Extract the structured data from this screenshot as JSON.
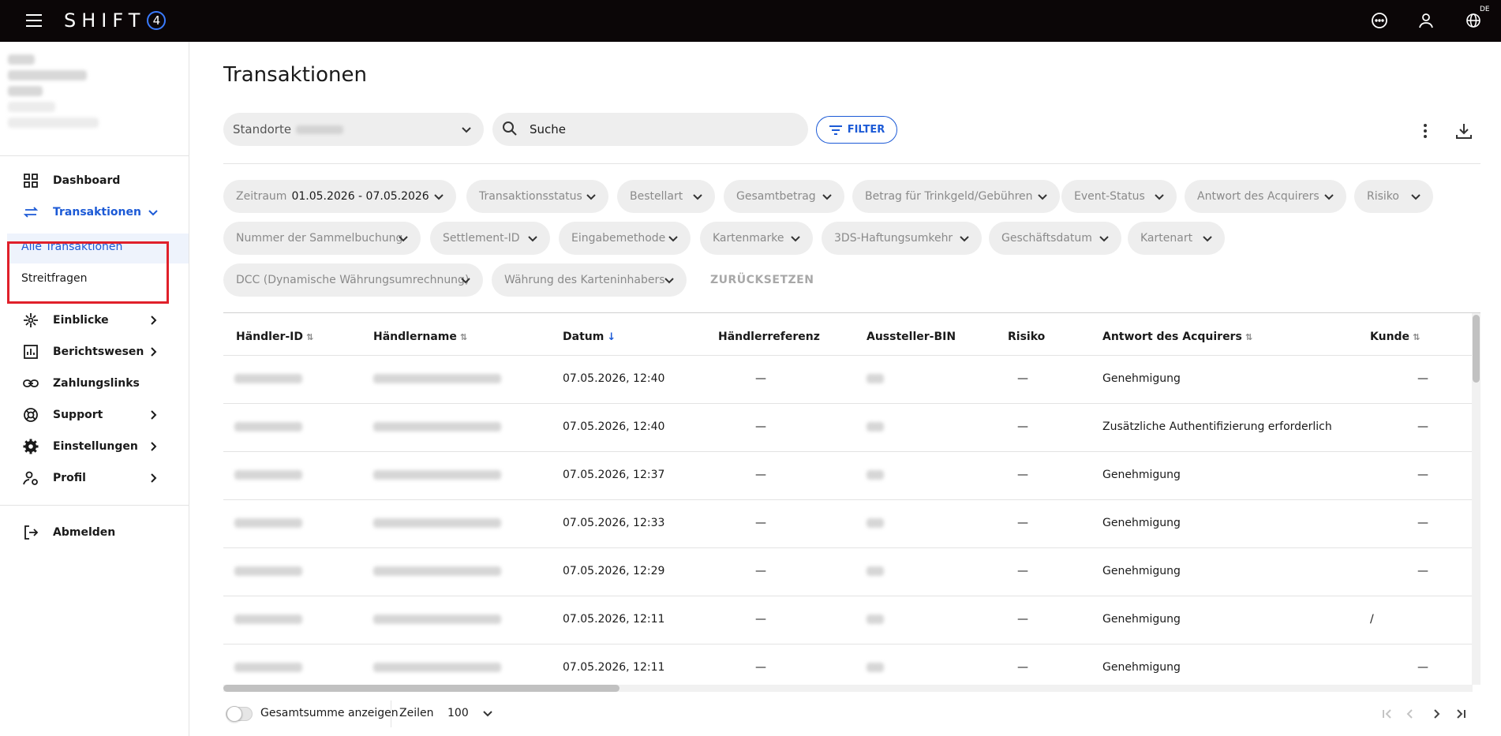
{
  "topbar": {
    "logo_text": "SHIFT",
    "logo_number": "4",
    "language_badge": "DE",
    "icons": [
      "menu-icon",
      "chat-icon",
      "user-icon",
      "globe-icon"
    ]
  },
  "sidebar": {
    "items": [
      {
        "label": "Dashboard",
        "icon": "dashboard-icon"
      },
      {
        "label": "Transaktionen",
        "icon": "transfer-arrows-icon"
      },
      {
        "label": "Alle Transaktionen"
      },
      {
        "label": "Streitfragen"
      },
      {
        "label": "Einblicke",
        "icon": "insights-icon"
      },
      {
        "label": "Berichtswesen",
        "icon": "chart-icon"
      },
      {
        "label": "Zahlungslinks",
        "icon": "link-icon"
      },
      {
        "label": "Support",
        "icon": "lifebuoy-icon"
      },
      {
        "label": "Einstellungen",
        "icon": "gear-icon"
      },
      {
        "label": "Profil",
        "icon": "profile-settings-icon"
      },
      {
        "label": "Abmelden",
        "icon": "logout-icon"
      }
    ]
  },
  "page": {
    "title": "Transaktionen",
    "location_label": "Standorte",
    "search_placeholder": "Suche",
    "filter_label": "FILTER",
    "reset_label": "ZURÜCKSETZEN"
  },
  "chips": [
    {
      "label": "Zeitraum",
      "value": "01.05.2026 - 07.05.2026"
    },
    {
      "label": "Transaktionsstatus"
    },
    {
      "label": "Bestellart"
    },
    {
      "label": "Gesamtbetrag"
    },
    {
      "label": "Betrag für Trinkgeld/Gebühren"
    },
    {
      "label": "Event-Status"
    },
    {
      "label": "Antwort des Acquirers"
    },
    {
      "label": "Risiko"
    },
    {
      "label": "Nummer der Sammelbuchung"
    },
    {
      "label": "Settlement-ID"
    },
    {
      "label": "Eingabemethode"
    },
    {
      "label": "Kartenmarke"
    },
    {
      "label": "3DS-Haftungsumkehr"
    },
    {
      "label": "Geschäftsdatum"
    },
    {
      "label": "Kartenart"
    },
    {
      "label": "DCC (Dynamische Währungsumrechnung)"
    },
    {
      "label": "Währung des Karteninhabers"
    }
  ],
  "table": {
    "columns": [
      "Händler-ID",
      "Händlername",
      "Datum",
      "Händlerreferenz",
      "Aussteller-BIN",
      "Risiko",
      "Antwort des Acquirers",
      "Kunde"
    ],
    "rows": [
      {
        "datum": "07.05.2026, 12:40",
        "referenz": "—",
        "risiko": "—",
        "antwort": "Genehmigung",
        "kunde": "—"
      },
      {
        "datum": "07.05.2026, 12:40",
        "referenz": "—",
        "risiko": "—",
        "antwort": "Zusätzliche Authentifizierung erforderlich",
        "kunde": "—"
      },
      {
        "datum": "07.05.2026, 12:37",
        "referenz": "—",
        "risiko": "—",
        "antwort": "Genehmigung",
        "kunde": "—"
      },
      {
        "datum": "07.05.2026, 12:33",
        "referenz": "—",
        "risiko": "—",
        "antwort": "Genehmigung",
        "kunde": "—"
      },
      {
        "datum": "07.05.2026, 12:29",
        "referenz": "—",
        "risiko": "—",
        "antwort": "Genehmigung",
        "kunde": "—"
      },
      {
        "datum": "07.05.2026, 12:11",
        "referenz": "—",
        "risiko": "—",
        "antwort": "Genehmigung",
        "kunde": "/"
      },
      {
        "datum": "07.05.2026, 12:11",
        "referenz": "—",
        "risiko": "—",
        "antwort": "Genehmigung",
        "kunde": "—"
      }
    ]
  },
  "footer": {
    "total_label": "Gesamtsumme anzeigen",
    "rows_label": "Zeilen",
    "rows_value": "100"
  },
  "colors": {
    "accent": "#1c5ad6",
    "topbar": "#0b0607",
    "highlight": "#e0202a"
  }
}
